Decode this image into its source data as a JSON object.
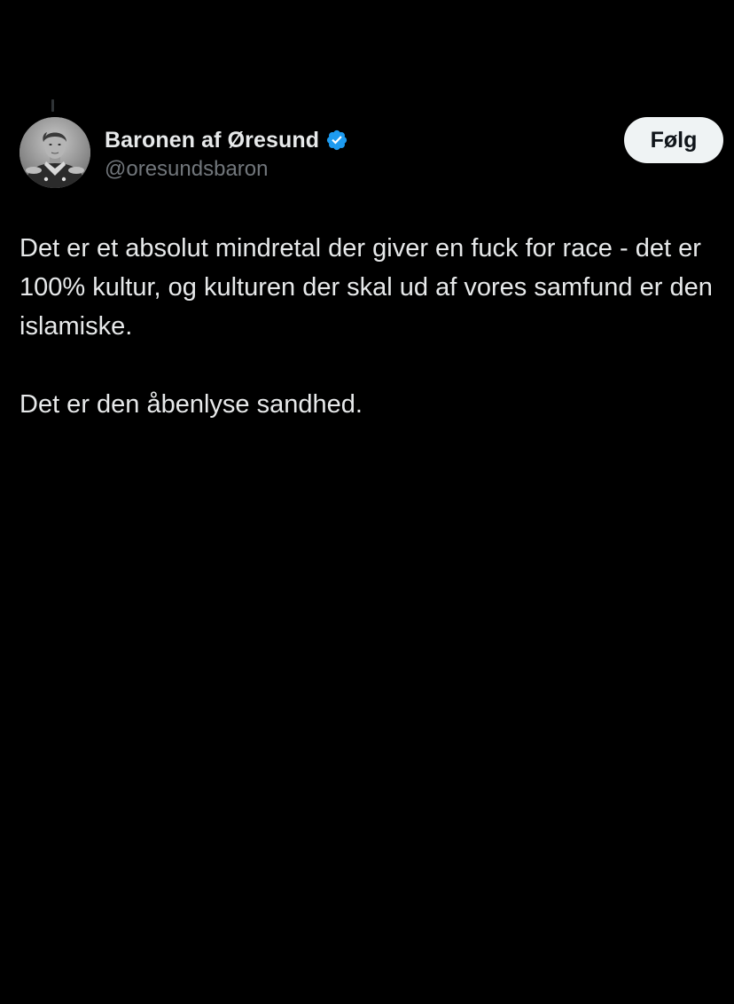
{
  "author": {
    "display_name": "Baronen af Øresund",
    "handle": "@oresundsbaron",
    "verified": true,
    "verified_color": "#1d9bf0",
    "avatar_icon": "portrait-avatar"
  },
  "follow_button": {
    "label": "Følg"
  },
  "tweet": {
    "paragraph_1": "Det er et absolut mindretal der giver en fuck for race - det er 100% kultur, og kulturen der skal ud af vores samfund er den islamiske.",
    "paragraph_2": "Det er den åbenlyse sandhed."
  },
  "colors": {
    "background": "#000000",
    "text_primary": "#e7e9ea",
    "text_secondary": "#71767b",
    "button_bg": "#eff3f4",
    "button_text": "#0f1419"
  }
}
